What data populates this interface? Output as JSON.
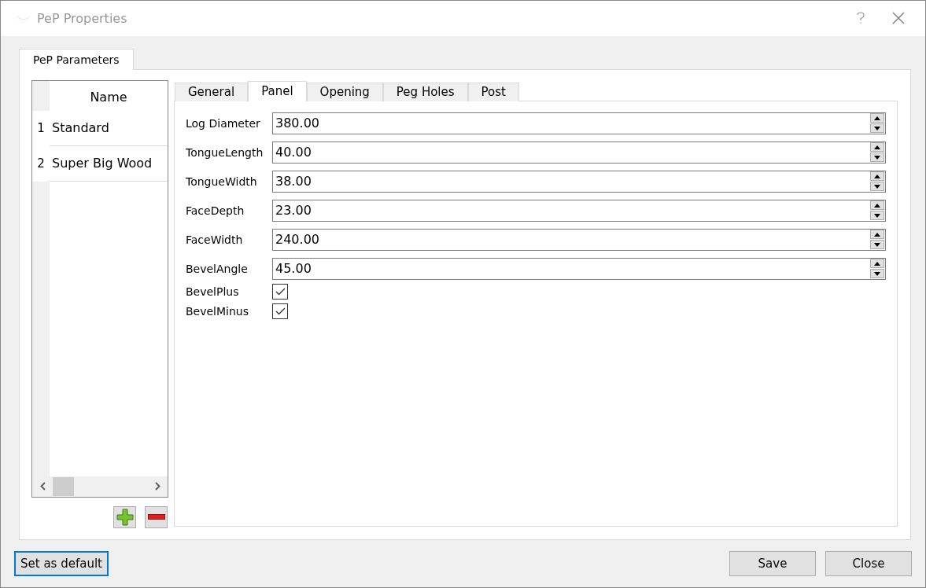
{
  "window": {
    "title": "PeP Properties"
  },
  "outer_tabs": [
    {
      "label": "PeP Parameters",
      "selected": true
    }
  ],
  "table": {
    "columns": [
      "Name"
    ],
    "rows": [
      {
        "index": "1",
        "name": "Standard",
        "selected": false
      },
      {
        "index": "2",
        "name": "Super Big Wood",
        "selected": false
      }
    ]
  },
  "tabs": [
    {
      "label": "General",
      "selected": false
    },
    {
      "label": "Panel",
      "selected": true
    },
    {
      "label": "Opening",
      "selected": false
    },
    {
      "label": "Peg Holes",
      "selected": false
    },
    {
      "label": "Post",
      "selected": false
    }
  ],
  "fields": [
    {
      "kind": "spin",
      "label": "Log Diameter",
      "value": "380.00"
    },
    {
      "kind": "spin",
      "label": "TongueLength",
      "value": "40.00"
    },
    {
      "kind": "spin",
      "label": "TongueWidth",
      "value": "38.00"
    },
    {
      "kind": "spin",
      "label": "FaceDepth",
      "value": "23.00"
    },
    {
      "kind": "spin",
      "label": "FaceWidth",
      "value": "240.00"
    },
    {
      "kind": "spin",
      "label": "BevelAngle",
      "value": "45.00"
    },
    {
      "kind": "check",
      "label": "BevelPlus",
      "checked": true
    },
    {
      "kind": "check",
      "label": "BevelMinus",
      "checked": true
    }
  ],
  "buttons": {
    "default": "Set as default",
    "save": "Save",
    "close": "Close"
  }
}
